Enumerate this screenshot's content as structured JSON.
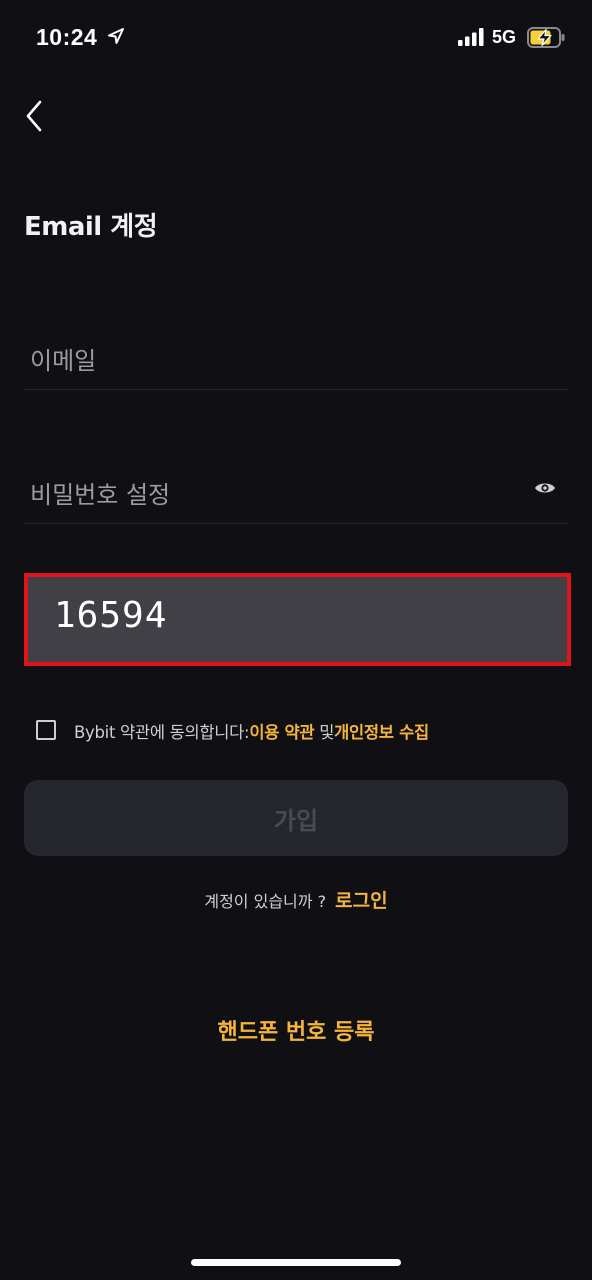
{
  "status_bar": {
    "time": "10:24",
    "network": "5G",
    "icons": [
      "location-arrow-icon",
      "signal-bars-icon",
      "battery-charging-icon"
    ]
  },
  "header": {
    "back_icon": "chevron-left-icon",
    "title": "Email 계정"
  },
  "form": {
    "email_placeholder": "이메일",
    "email_value": "",
    "password_placeholder": "비밀번호 설정",
    "password_value": "",
    "password_toggle_icon": "eye-icon",
    "code_value": "16594"
  },
  "agreement": {
    "checked": false,
    "prefix": "Bybit 약관에 동의합니다:",
    "terms_link": "이용 약관",
    "joiner": "및",
    "privacy_link": "개인정보 수집"
  },
  "signup_button": "가입",
  "login_row": {
    "question": "계정이 있습니까 ?",
    "link": "로그인"
  },
  "phone_signup_link": "핸드폰 번호 등록",
  "colors": {
    "background": "#101014",
    "accent": "#f5b43b",
    "highlight_border": "#e1141c",
    "button_bg": "#26272e"
  }
}
